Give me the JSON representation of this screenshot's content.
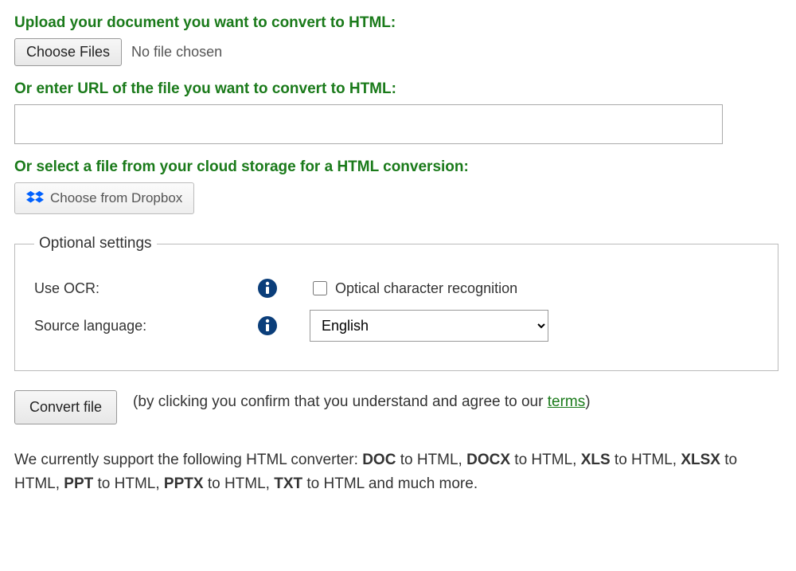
{
  "upload": {
    "heading": "Upload your document you want to convert to HTML:",
    "choose_files_label": "Choose Files",
    "no_file_text": "No file chosen"
  },
  "url": {
    "heading": "Or enter URL of the file you want to convert to HTML:",
    "value": ""
  },
  "cloud": {
    "heading": "Or select a file from your cloud storage for a HTML conversion:",
    "dropbox_label": "Choose from Dropbox"
  },
  "optional": {
    "legend": "Optional settings",
    "ocr_label": "Use OCR:",
    "ocr_checkbox_text": "Optical character recognition",
    "lang_label": "Source language:",
    "lang_selected": "English"
  },
  "convert": {
    "button_label": "Convert file",
    "agree_prefix": "(by clicking you confirm that you understand and agree to our ",
    "terms_link": "terms",
    "agree_suffix": ")"
  },
  "footer": {
    "prefix": "We currently support the following HTML converter: ",
    "f1": "DOC",
    "t1": " to HTML, ",
    "f2": "DOCX",
    "t2": " to HTML, ",
    "f3": "XLS",
    "t3": " to HTML, ",
    "f4": "XLSX",
    "t4": " to HTML, ",
    "f5": "PPT",
    "t5": " to HTML, ",
    "f6": "PPTX",
    "t6": " to HTML, ",
    "f7": "TXT",
    "t7": " to HTML and much more."
  }
}
